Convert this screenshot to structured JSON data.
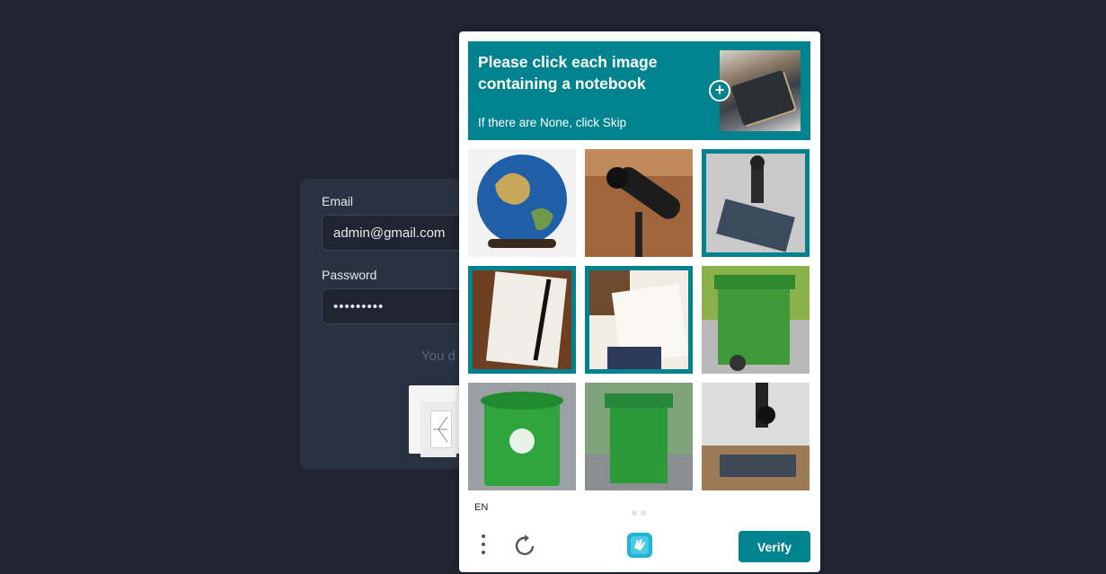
{
  "login": {
    "email_label": "Email",
    "email_value": "admin@gmail.com",
    "password_label": "Password",
    "password_value": "•••••••••",
    "muted_text": "You d"
  },
  "captcha": {
    "prompt_title": "Please click each image containing a notebook",
    "prompt_subtitle": "If there are None, click Skip",
    "language": "EN",
    "verify_label": "Verify",
    "accent_color": "#00838f",
    "tiles": [
      {
        "subject": "globe",
        "selected": false
      },
      {
        "subject": "telescope",
        "selected": false
      },
      {
        "subject": "microscope",
        "selected": true
      },
      {
        "subject": "notebook with pen",
        "selected": true
      },
      {
        "subject": "open notebook",
        "selected": true
      },
      {
        "subject": "green trash bin",
        "selected": false
      },
      {
        "subject": "green trash bin",
        "selected": false
      },
      {
        "subject": "green trash bin",
        "selected": false
      },
      {
        "subject": "microscope",
        "selected": false
      }
    ]
  }
}
